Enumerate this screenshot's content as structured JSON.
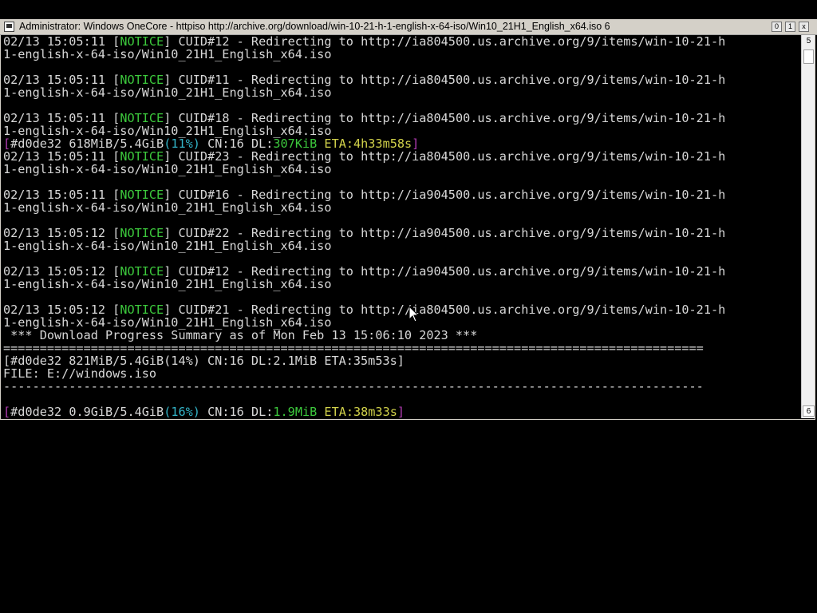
{
  "window": {
    "title": "Administrator:  Windows OneCore - httpiso  http://archive.org/download/win-10-21-h-1-english-x-64-iso/Win10_21H1_English_x64.iso 6",
    "btn_minimize": "0",
    "btn_maximize": "1",
    "btn_close": "x"
  },
  "scrollbar": {
    "up_label": "5",
    "down_label": "6"
  },
  "console": {
    "lines": [
      {
        "type": "notice",
        "ts": "02/13 15:05:11",
        "tag": "NOTICE",
        "msg": " CUID#12 - Redirecting to http://ia804500.us.archive.org/9/items/win-10-21-h"
      },
      {
        "type": "text",
        "text": "1-english-x-64-iso/Win10_21H1_English_x64.iso"
      },
      {
        "type": "text",
        "text": ""
      },
      {
        "type": "notice",
        "ts": "02/13 15:05:11",
        "tag": "NOTICE",
        "msg": " CUID#11 - Redirecting to http://ia804500.us.archive.org/9/items/win-10-21-h"
      },
      {
        "type": "text",
        "text": "1-english-x-64-iso/Win10_21H1_English_x64.iso"
      },
      {
        "type": "text",
        "text": ""
      },
      {
        "type": "notice",
        "ts": "02/13 15:05:11",
        "tag": "NOTICE",
        "msg": " CUID#18 - Redirecting to http://ia804500.us.archive.org/9/items/win-10-21-h"
      },
      {
        "type": "text",
        "text": "1-english-x-64-iso/Win10_21H1_English_x64.iso"
      },
      {
        "type": "progress",
        "id": "#d0de32",
        "size": "618MiB/5.4GiB",
        "pct": "(11%)",
        "cn": "CN:16",
        "dl_label": "DL:",
        "dl": "307KiB",
        "eta": "ETA:4h33m58s",
        "style": "magenta"
      },
      {
        "type": "notice",
        "ts": "02/13 15:05:11",
        "tag": "NOTICE",
        "msg": " CUID#23 - Redirecting to http://ia804500.us.archive.org/9/items/win-10-21-h"
      },
      {
        "type": "text",
        "text": "1-english-x-64-iso/Win10_21H1_English_x64.iso"
      },
      {
        "type": "text",
        "text": ""
      },
      {
        "type": "notice",
        "ts": "02/13 15:05:11",
        "tag": "NOTICE",
        "msg": " CUID#16 - Redirecting to http://ia904500.us.archive.org/9/items/win-10-21-h"
      },
      {
        "type": "text",
        "text": "1-english-x-64-iso/Win10_21H1_English_x64.iso"
      },
      {
        "type": "text",
        "text": ""
      },
      {
        "type": "notice",
        "ts": "02/13 15:05:12",
        "tag": "NOTICE",
        "msg": " CUID#22 - Redirecting to http://ia904500.us.archive.org/9/items/win-10-21-h"
      },
      {
        "type": "text",
        "text": "1-english-x-64-iso/Win10_21H1_English_x64.iso"
      },
      {
        "type": "text",
        "text": ""
      },
      {
        "type": "notice",
        "ts": "02/13 15:05:12",
        "tag": "NOTICE",
        "msg": " CUID#12 - Redirecting to http://ia904500.us.archive.org/9/items/win-10-21-h"
      },
      {
        "type": "text",
        "text": "1-english-x-64-iso/Win10_21H1_English_x64.iso"
      },
      {
        "type": "text",
        "text": ""
      },
      {
        "type": "notice",
        "ts": "02/13 15:05:12",
        "tag": "NOTICE",
        "msg": " CUID#21 - Redirecting to http://ia804500.us.archive.org/9/items/win-10-21-h"
      },
      {
        "type": "text",
        "text": "1-english-x-64-iso/Win10_21H1_English_x64.iso"
      },
      {
        "type": "text",
        "text": " *** Download Progress Summary as of Mon Feb 13 15:06:10 2023 ***"
      },
      {
        "type": "text",
        "text": "================================================================================================"
      },
      {
        "type": "text",
        "text": "[#d0de32 821MiB/5.4GiB(14%) CN:16 DL:2.1MiB ETA:35m53s]"
      },
      {
        "type": "text",
        "text": "FILE: E://windows.iso"
      },
      {
        "type": "text",
        "text": "------------------------------------------------------------------------------------------------"
      },
      {
        "type": "text",
        "text": ""
      },
      {
        "type": "progress",
        "id": "#d0de32",
        "size": "0.9GiB/5.4GiB",
        "pct": "(16%)",
        "cn": "CN:16",
        "dl_label": "DL:",
        "dl": "1.9MiB",
        "eta": "ETA:38m33s",
        "style": "green"
      }
    ]
  }
}
